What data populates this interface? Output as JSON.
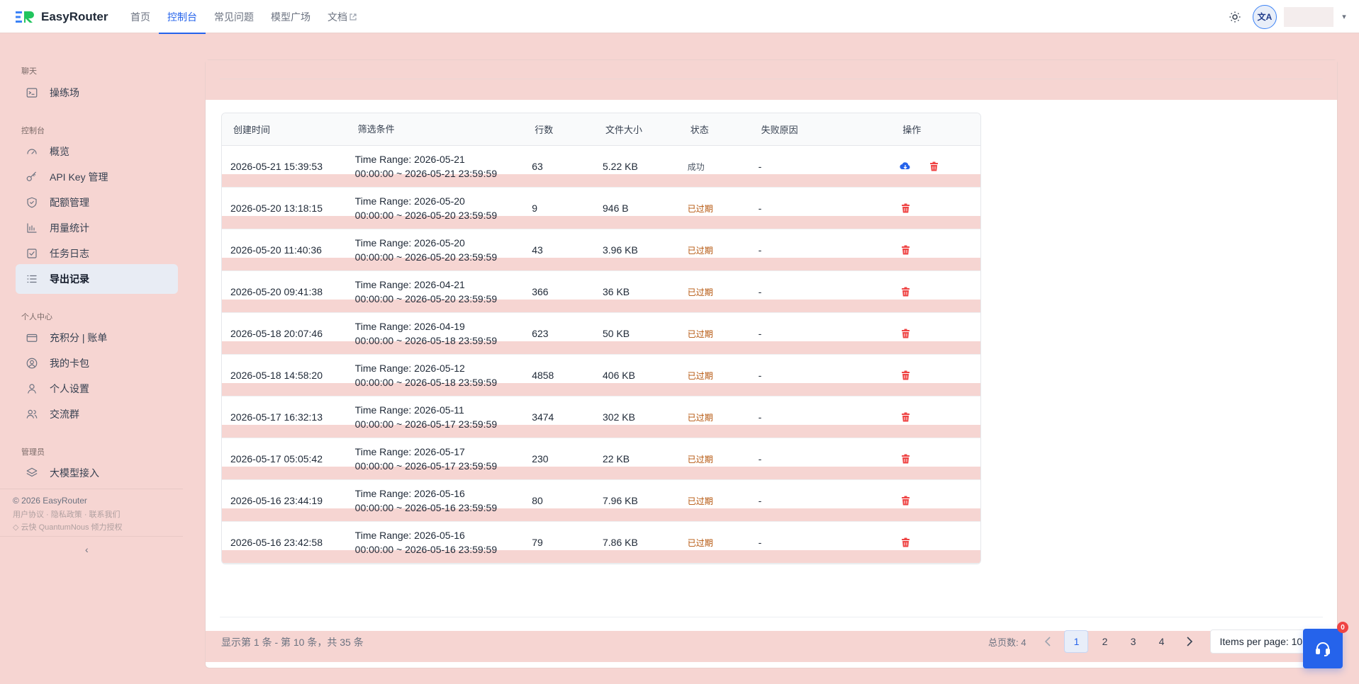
{
  "app": {
    "name": "EasyRouter"
  },
  "nav": {
    "items": [
      {
        "label": "首页"
      },
      {
        "label": "控制台"
      },
      {
        "label": "常见问题"
      },
      {
        "label": "模型广场"
      },
      {
        "label": "文档"
      }
    ],
    "active_index": 1
  },
  "header": {
    "lang_label": "文A"
  },
  "sidebar": {
    "sections": [
      {
        "title": "聊天",
        "items": [
          {
            "label": "操练场",
            "icon": "terminal-icon"
          }
        ]
      },
      {
        "title": "控制台",
        "items": [
          {
            "label": "概览",
            "icon": "gauge-icon"
          },
          {
            "label": "API Key 管理",
            "icon": "key-icon"
          },
          {
            "label": "配额管理",
            "icon": "shield-icon"
          },
          {
            "label": "用量统计",
            "icon": "bar-chart-icon"
          },
          {
            "label": "任务日志",
            "icon": "checkbox-icon"
          },
          {
            "label": "导出记录",
            "icon": "list-icon"
          }
        ]
      },
      {
        "title": "个人中心",
        "items": [
          {
            "label": "充积分 | 账单",
            "icon": "credit-card-icon"
          },
          {
            "label": "我的卡包",
            "icon": "user-circle-icon"
          },
          {
            "label": "个人设置",
            "icon": "user-icon"
          },
          {
            "label": "交流群",
            "icon": "users-icon"
          }
        ]
      },
      {
        "title": "管理员",
        "items": [
          {
            "label": "大模型接入",
            "icon": "layers-icon"
          }
        ]
      }
    ],
    "active_label": "导出记录",
    "footer": {
      "copyright": "© 2026 EasyRouter",
      "links": "用户协议 · 隐私政策 · 联系我们",
      "powered": "◇ 云快 QuantumNous 倾力授权"
    }
  },
  "table": {
    "headers": [
      "创建时间",
      "筛选条件",
      "行数",
      "文件大小",
      "状态",
      "失败原因",
      "操作"
    ],
    "rows": [
      {
        "created": "2026-05-21 15:39:53",
        "filter1": "Time Range: 2026-05-21",
        "filter2": "00:00:00 ~ 2026-05-21 23:59:59",
        "rows": "63",
        "size": "5.22 KB",
        "status": "成功",
        "reason": "-"
      },
      {
        "created": "2026-05-20 13:18:15",
        "filter1": "Time Range: 2026-05-20",
        "filter2": "00:00:00 ~ 2026-05-20 23:59:59",
        "rows": "9",
        "size": "946 B",
        "status": "已过期",
        "reason": "-"
      },
      {
        "created": "2026-05-20 11:40:36",
        "filter1": "Time Range: 2026-05-20",
        "filter2": "00:00:00 ~ 2026-05-20 23:59:59",
        "rows": "43",
        "size": "3.96 KB",
        "status": "已过期",
        "reason": "-"
      },
      {
        "created": "2026-05-20 09:41:38",
        "filter1": "Time Range: 2026-04-21",
        "filter2": "00:00:00 ~ 2026-05-20 23:59:59",
        "rows": "366",
        "size": "36 KB",
        "status": "已过期",
        "reason": "-"
      },
      {
        "created": "2026-05-18 20:07:46",
        "filter1": "Time Range: 2026-04-19",
        "filter2": "00:00:00 ~ 2026-05-18 23:59:59",
        "rows": "623",
        "size": "50 KB",
        "status": "已过期",
        "reason": "-"
      },
      {
        "created": "2026-05-18 14:58:20",
        "filter1": "Time Range: 2026-05-12",
        "filter2": "00:00:00 ~ 2026-05-18 23:59:59",
        "rows": "4858",
        "size": "406 KB",
        "status": "已过期",
        "reason": "-"
      },
      {
        "created": "2026-05-17 16:32:13",
        "filter1": "Time Range: 2026-05-11",
        "filter2": "00:00:00 ~ 2026-05-17 23:59:59",
        "rows": "3474",
        "size": "302 KB",
        "status": "已过期",
        "reason": "-"
      },
      {
        "created": "2026-05-17 05:05:42",
        "filter1": "Time Range: 2026-05-17",
        "filter2": "00:00:00 ~ 2026-05-17 23:59:59",
        "rows": "230",
        "size": "22 KB",
        "status": "已过期",
        "reason": "-"
      },
      {
        "created": "2026-05-16 23:44:19",
        "filter1": "Time Range: 2026-05-16",
        "filter2": "00:00:00 ~ 2026-05-16 23:59:59",
        "rows": "80",
        "size": "7.96 KB",
        "status": "已过期",
        "reason": "-"
      },
      {
        "created": "2026-05-16 23:42:58",
        "filter1": "Time Range: 2026-05-16",
        "filter2": "00:00:00 ~ 2026-05-16 23:59:59",
        "rows": "79",
        "size": "7.86 KB",
        "status": "已过期",
        "reason": "-"
      }
    ]
  },
  "pagination": {
    "info": "显示第 1 条 - 第 10 条，共 35 条",
    "total_pages_label": "总页数:",
    "total_pages": "4",
    "pages": [
      "1",
      "2",
      "3",
      "4"
    ],
    "current": "1",
    "per_page_label": "Items per page: 10"
  },
  "support": {
    "badge": "0"
  },
  "colors": {
    "accent": "#2563eb",
    "danger": "#ef4444",
    "expired": "#b45309",
    "highlight_band": "#f6d5d2"
  }
}
